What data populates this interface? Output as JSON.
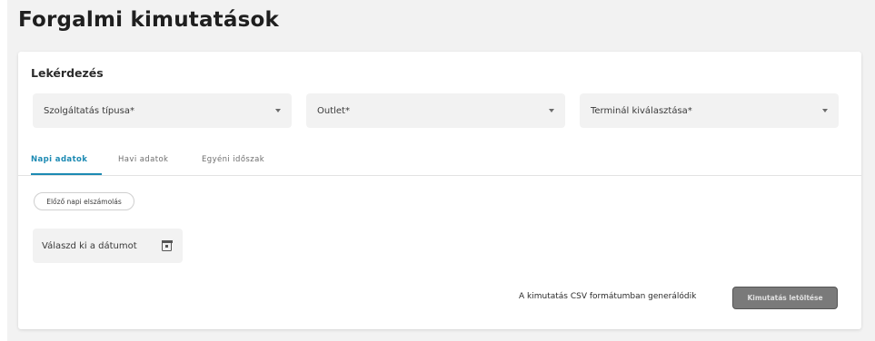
{
  "page": {
    "title": "Forgalmi kimutatások"
  },
  "query": {
    "title": "Lekérdezés",
    "selects": [
      {
        "label": "Szolgáltatás típusa*"
      },
      {
        "label": "Outlet*"
      },
      {
        "label": "Terminál kiválasztása*"
      }
    ]
  },
  "tabs": [
    {
      "label": "Napi adatok",
      "active": true
    },
    {
      "label": "Havi adatok",
      "active": false
    },
    {
      "label": "Egyéni időszak",
      "active": false
    }
  ],
  "daily": {
    "chip_label": "Előző napi elszámolás",
    "date_placeholder": "Válaszd ki a dátumot",
    "date_icon": "calendar-icon"
  },
  "footer": {
    "note": "A kimutatás CSV formátumban generálódik",
    "download_label": "Kimutatás letöltése"
  },
  "colors": {
    "accent": "#1c8ab3",
    "button_disabled": "#7a7a7a",
    "field_bg": "#f2f2f2"
  }
}
